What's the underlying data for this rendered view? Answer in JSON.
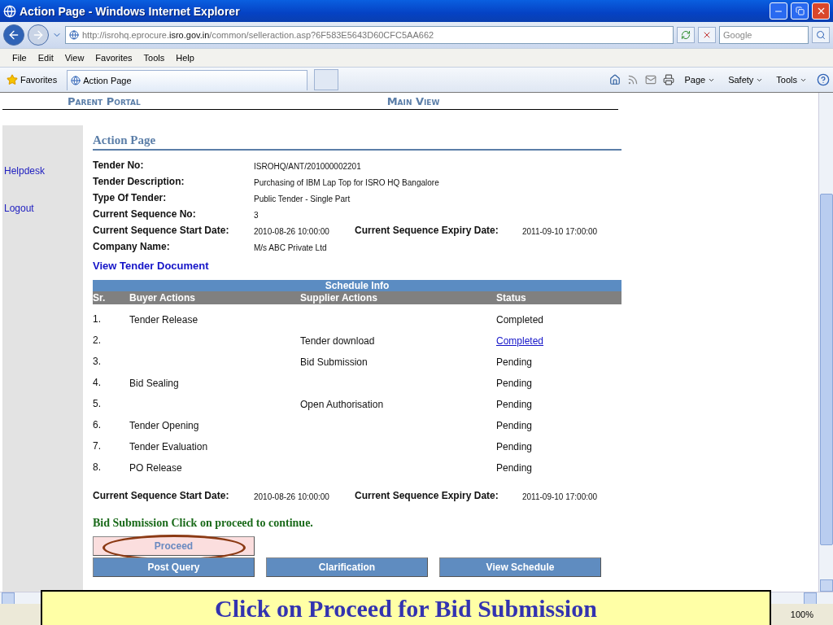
{
  "window": {
    "title": "Action Page - Windows Internet Explorer"
  },
  "address_bar": {
    "url_prefix": "http://isrohq.eprocure.",
    "url_domain": "isro.gov.in",
    "url_rest": "/common/selleraction.asp?6F583E5643D60CFC5AA662",
    "search_placeholder": "Google"
  },
  "menu": [
    "File",
    "Edit",
    "View",
    "Favorites",
    "Tools",
    "Help"
  ],
  "favorites_bar": {
    "favorites": "Favorites",
    "tabs": [
      {
        "label": "Action Page",
        "selected": true
      }
    ],
    "commands": [
      "Page",
      "Safety",
      "Tools"
    ]
  },
  "page": {
    "header_links": [
      "Parent Portal",
      "Main View"
    ],
    "sidebar": [
      "Helpdesk",
      "Logout"
    ],
    "heading": "Action Page",
    "details": [
      [
        {
          "label": "Tender No:",
          "value": "ISROHQ/ANT/201000002201"
        }
      ],
      [
        {
          "label": "Tender Description:",
          "value": "Purchasing of IBM Lap Top for ISRO HQ Bangalore"
        }
      ],
      [
        {
          "label": "Type Of Tender:",
          "value": "Public Tender - Single Part"
        }
      ],
      [
        {
          "label": "Current Sequence No:",
          "value": "3"
        }
      ],
      [
        {
          "label": "Current Sequence Start Date:",
          "value": "2010-08-26 10:00:00"
        },
        {
          "label": "Current Sequence Expiry Date:",
          "value": "2011-09-10 17:00:00"
        }
      ],
      [
        {
          "label": "Company Name:",
          "value": "M/s ABC Private Ltd"
        }
      ]
    ],
    "document_link": "View Tender Document",
    "schedule": {
      "title": "Schedule Info",
      "columns": [
        "Sr.",
        "Buyer Actions",
        "Supplier Actions",
        "Status"
      ],
      "rows": [
        {
          "sr": "1.",
          "buyer": "Tender Release",
          "supplier": "",
          "status": "Completed",
          "kind": "text"
        },
        {
          "sr": "2.",
          "buyer": "",
          "supplier": "Tender download",
          "status": "Completed",
          "kind": "link"
        },
        {
          "sr": "3.",
          "buyer": "",
          "supplier": "Bid Submission",
          "status": "Pending",
          "kind": "text"
        },
        {
          "sr": "4.",
          "buyer": "Bid Sealing",
          "supplier": "",
          "status": "Pending",
          "kind": "text"
        },
        {
          "sr": "5.",
          "buyer": "",
          "supplier": "Open Authorisation",
          "status": "Pending",
          "kind": "text"
        },
        {
          "sr": "6.",
          "buyer": "Tender Opening",
          "supplier": "",
          "status": "Pending",
          "kind": "text"
        },
        {
          "sr": "7.",
          "buyer": "Tender Evaluation",
          "supplier": "",
          "status": "Pending",
          "kind": "text"
        },
        {
          "sr": "8.",
          "buyer": "PO Release",
          "supplier": "",
          "status": "Pending",
          "kind": "text"
        }
      ]
    },
    "footer_dates": [
      {
        "label": "Current Sequence Start Date:",
        "value": "2010-08-26 10:00:00"
      },
      {
        "label": "Current Sequence Expiry Date:",
        "value": "2011-09-10 17:00:00"
      }
    ],
    "message": "Bid Submission Click on proceed to continue.",
    "button_rows": [
      [
        {
          "label": "Proceed",
          "kind": "proceed",
          "circled": true
        }
      ],
      [
        {
          "label": "Post Query",
          "kind": "action",
          "circled": false
        },
        {
          "label": "Clarification",
          "kind": "action",
          "circled": false
        },
        {
          "label": "View Schedule",
          "kind": "action",
          "circled": false
        }
      ]
    ]
  },
  "caption": "Click on Proceed for Bid Submission",
  "status_bar": {
    "zoom": "100%"
  }
}
